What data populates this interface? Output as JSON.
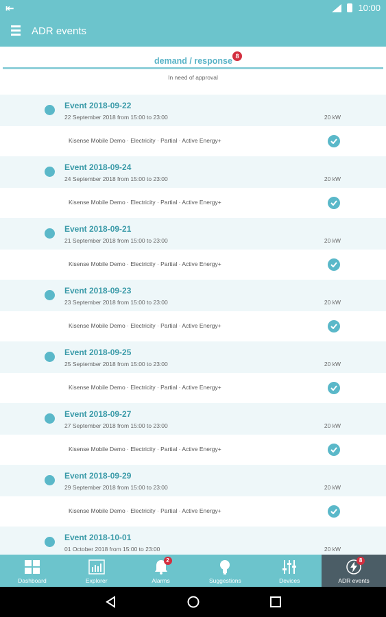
{
  "status_bar": {
    "time": "10:00",
    "left_icon": "cast-icon"
  },
  "app_bar": {
    "title": "ADR events",
    "menu_icon": "hamburger-icon"
  },
  "tab": {
    "label": "demand / response",
    "badge": "8",
    "subtitle": "In need of approval"
  },
  "colors": {
    "primary": "#6cc4cc",
    "accent": "#5ab8c9",
    "badge": "#d32f3f",
    "active_nav": "#4b5d66"
  },
  "events": [
    {
      "name": "Event 2018-09-22",
      "range": "22 September 2018 from 15:00 to 23:00",
      "power": "20 kW",
      "desc": "Kisense Mobile Demo · Electricity · Partial · Active Energy+"
    },
    {
      "name": "Event 2018-09-24",
      "range": "24 September 2018 from 15:00 to 23:00",
      "power": "20 kW",
      "desc": "Kisense Mobile Demo · Electricity · Partial · Active Energy+"
    },
    {
      "name": "Event 2018-09-21",
      "range": "21 September 2018 from 15:00 to 23:00",
      "power": "20 kW",
      "desc": "Kisense Mobile Demo · Electricity · Partial · Active Energy+"
    },
    {
      "name": "Event 2018-09-23",
      "range": "23 September 2018 from 15:00 to 23:00",
      "power": "20 kW",
      "desc": "Kisense Mobile Demo · Electricity · Partial · Active Energy+"
    },
    {
      "name": "Event 2018-09-25",
      "range": "25 September 2018 from 15:00 to 23:00",
      "power": "20 kW",
      "desc": "Kisense Mobile Demo · Electricity · Partial · Active Energy+"
    },
    {
      "name": "Event 2018-09-27",
      "range": "27 September 2018 from 15:00 to 23:00",
      "power": "20 kW",
      "desc": "Kisense Mobile Demo · Electricity · Partial · Active Energy+"
    },
    {
      "name": "Event 2018-09-29",
      "range": "29 September 2018 from 15:00 to 23:00",
      "power": "20 kW",
      "desc": "Kisense Mobile Demo · Electricity · Partial · Active Energy+"
    },
    {
      "name": "Event 2018-10-01",
      "range": "01 October 2018 from 15:00 to 23:00",
      "power": "20 kW",
      "desc": ""
    }
  ],
  "bottom_nav": [
    {
      "label": "Dashboard",
      "icon": "dashboard-icon",
      "badge": ""
    },
    {
      "label": "Explorer",
      "icon": "chart-icon",
      "badge": ""
    },
    {
      "label": "Alarms",
      "icon": "bell-icon",
      "badge": "2"
    },
    {
      "label": "Suggestions",
      "icon": "lightbulb-icon",
      "badge": ""
    },
    {
      "label": "Devices",
      "icon": "sliders-icon",
      "badge": ""
    },
    {
      "label": "ADR events",
      "icon": "lightning-icon",
      "badge": "8"
    }
  ]
}
